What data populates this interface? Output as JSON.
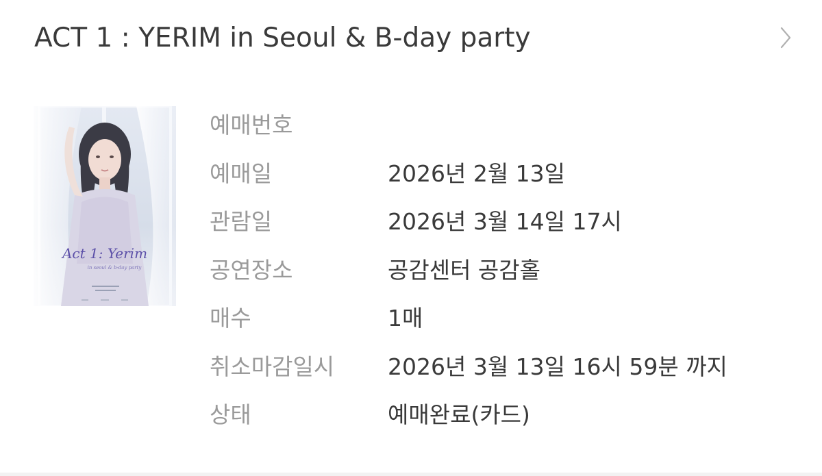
{
  "header": {
    "title": "ACT 1 : YERIM in Seoul & B-day party",
    "chevron_icon": "chevron-right-icon"
  },
  "poster": {
    "script_text": "Act 1: Yerim",
    "subtitle_text": "in seoul & b-day party"
  },
  "details": [
    {
      "label": "예매번호",
      "value": ""
    },
    {
      "label": "예매일",
      "value": "2026년 2월 13일"
    },
    {
      "label": "관람일",
      "value": "2026년 3월 14일 17시"
    },
    {
      "label": "공연장소",
      "value": "공감센터 공감홀"
    },
    {
      "label": "매수",
      "value": "1매"
    },
    {
      "label": "취소마감일시",
      "value": "2026년 3월 13일 16시 59분 까지"
    },
    {
      "label": "상태",
      "value": "예매완료(카드)"
    }
  ],
  "colors": {
    "title": "#3a3a3a",
    "label": "#9a9a9a",
    "value": "#3a3a3a",
    "chevron": "#b0b0b0"
  }
}
